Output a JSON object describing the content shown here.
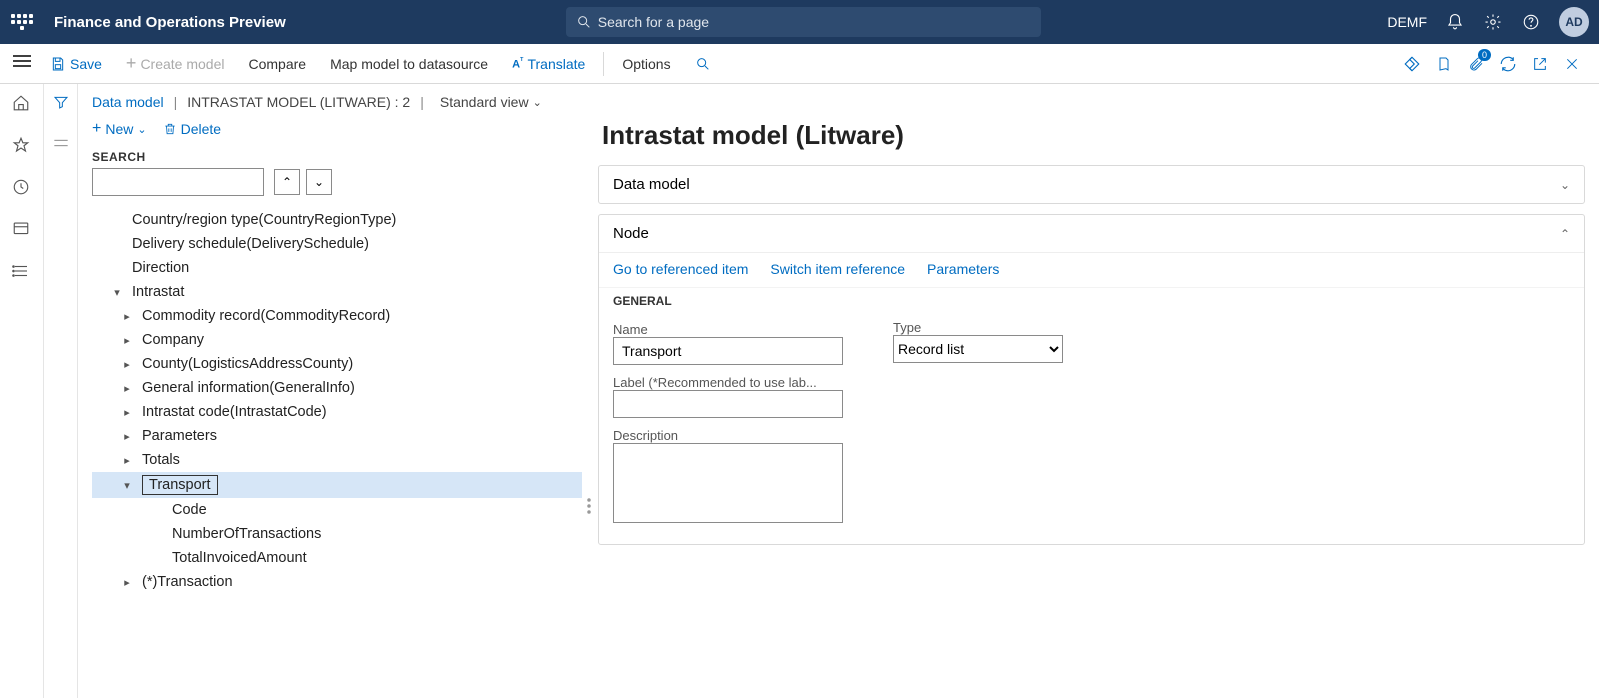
{
  "topbar": {
    "title": "Finance and Operations Preview",
    "search_placeholder": "Search for a page",
    "entity": "DEMF",
    "avatar": "AD"
  },
  "actionbar": {
    "save": "Save",
    "create_model": "Create model",
    "compare": "Compare",
    "map_model": "Map model to datasource",
    "translate": "Translate",
    "options": "Options",
    "paperclip_badge": "0"
  },
  "breadcrumb": {
    "root": "Data model",
    "path": "INTRASTAT MODEL (LITWARE) : 2",
    "view": "Standard view"
  },
  "leftpane": {
    "new": "New",
    "delete": "Delete",
    "search_label": "SEARCH"
  },
  "tree": {
    "items": [
      {
        "level": "indent0",
        "caret": "",
        "label": "Country/region type(CountryRegionType)",
        "sel": false
      },
      {
        "level": "indent0",
        "caret": "",
        "label": "Delivery schedule(DeliverySchedule)",
        "sel": false
      },
      {
        "level": "indent0",
        "caret": "",
        "label": "Direction",
        "sel": false
      },
      {
        "level": "indent1",
        "caret": "▾",
        "label": "Intrastat",
        "sel": false
      },
      {
        "level": "indent2",
        "caret": "▸",
        "label": "Commodity record(CommodityRecord)",
        "sel": false
      },
      {
        "level": "indent2",
        "caret": "▸",
        "label": "Company",
        "sel": false
      },
      {
        "level": "indent2",
        "caret": "▸",
        "label": "County(LogisticsAddressCounty)",
        "sel": false
      },
      {
        "level": "indent2",
        "caret": "▸",
        "label": "General information(GeneralInfo)",
        "sel": false
      },
      {
        "level": "indent2",
        "caret": "▸",
        "label": "Intrastat code(IntrastatCode)",
        "sel": false
      },
      {
        "level": "indent2",
        "caret": "▸",
        "label": "Parameters",
        "sel": false
      },
      {
        "level": "indent2",
        "caret": "▸",
        "label": "Totals",
        "sel": false
      },
      {
        "level": "indent2",
        "caret": "▾",
        "label": "Transport",
        "sel": true
      },
      {
        "level": "indent3",
        "caret": "",
        "label": "Code",
        "sel": false
      },
      {
        "level": "indent3",
        "caret": "",
        "label": "NumberOfTransactions",
        "sel": false
      },
      {
        "level": "indent3",
        "caret": "",
        "label": "TotalInvoicedAmount",
        "sel": false
      },
      {
        "level": "indent2",
        "caret": "▸",
        "label": "(*)Transaction",
        "sel": false
      }
    ]
  },
  "rightpane": {
    "title": "Intrastat model (Litware)",
    "card_data_model": "Data model",
    "card_node": "Node",
    "links": {
      "go_ref": "Go to referenced item",
      "switch_ref": "Switch item reference",
      "params": "Parameters"
    },
    "general_label": "GENERAL",
    "name_label": "Name",
    "name_value": "Transport",
    "label_label": "Label (*Recommended to use lab...",
    "label_value": "",
    "desc_label": "Description",
    "desc_value": "",
    "type_label": "Type",
    "type_value": "Record list"
  }
}
